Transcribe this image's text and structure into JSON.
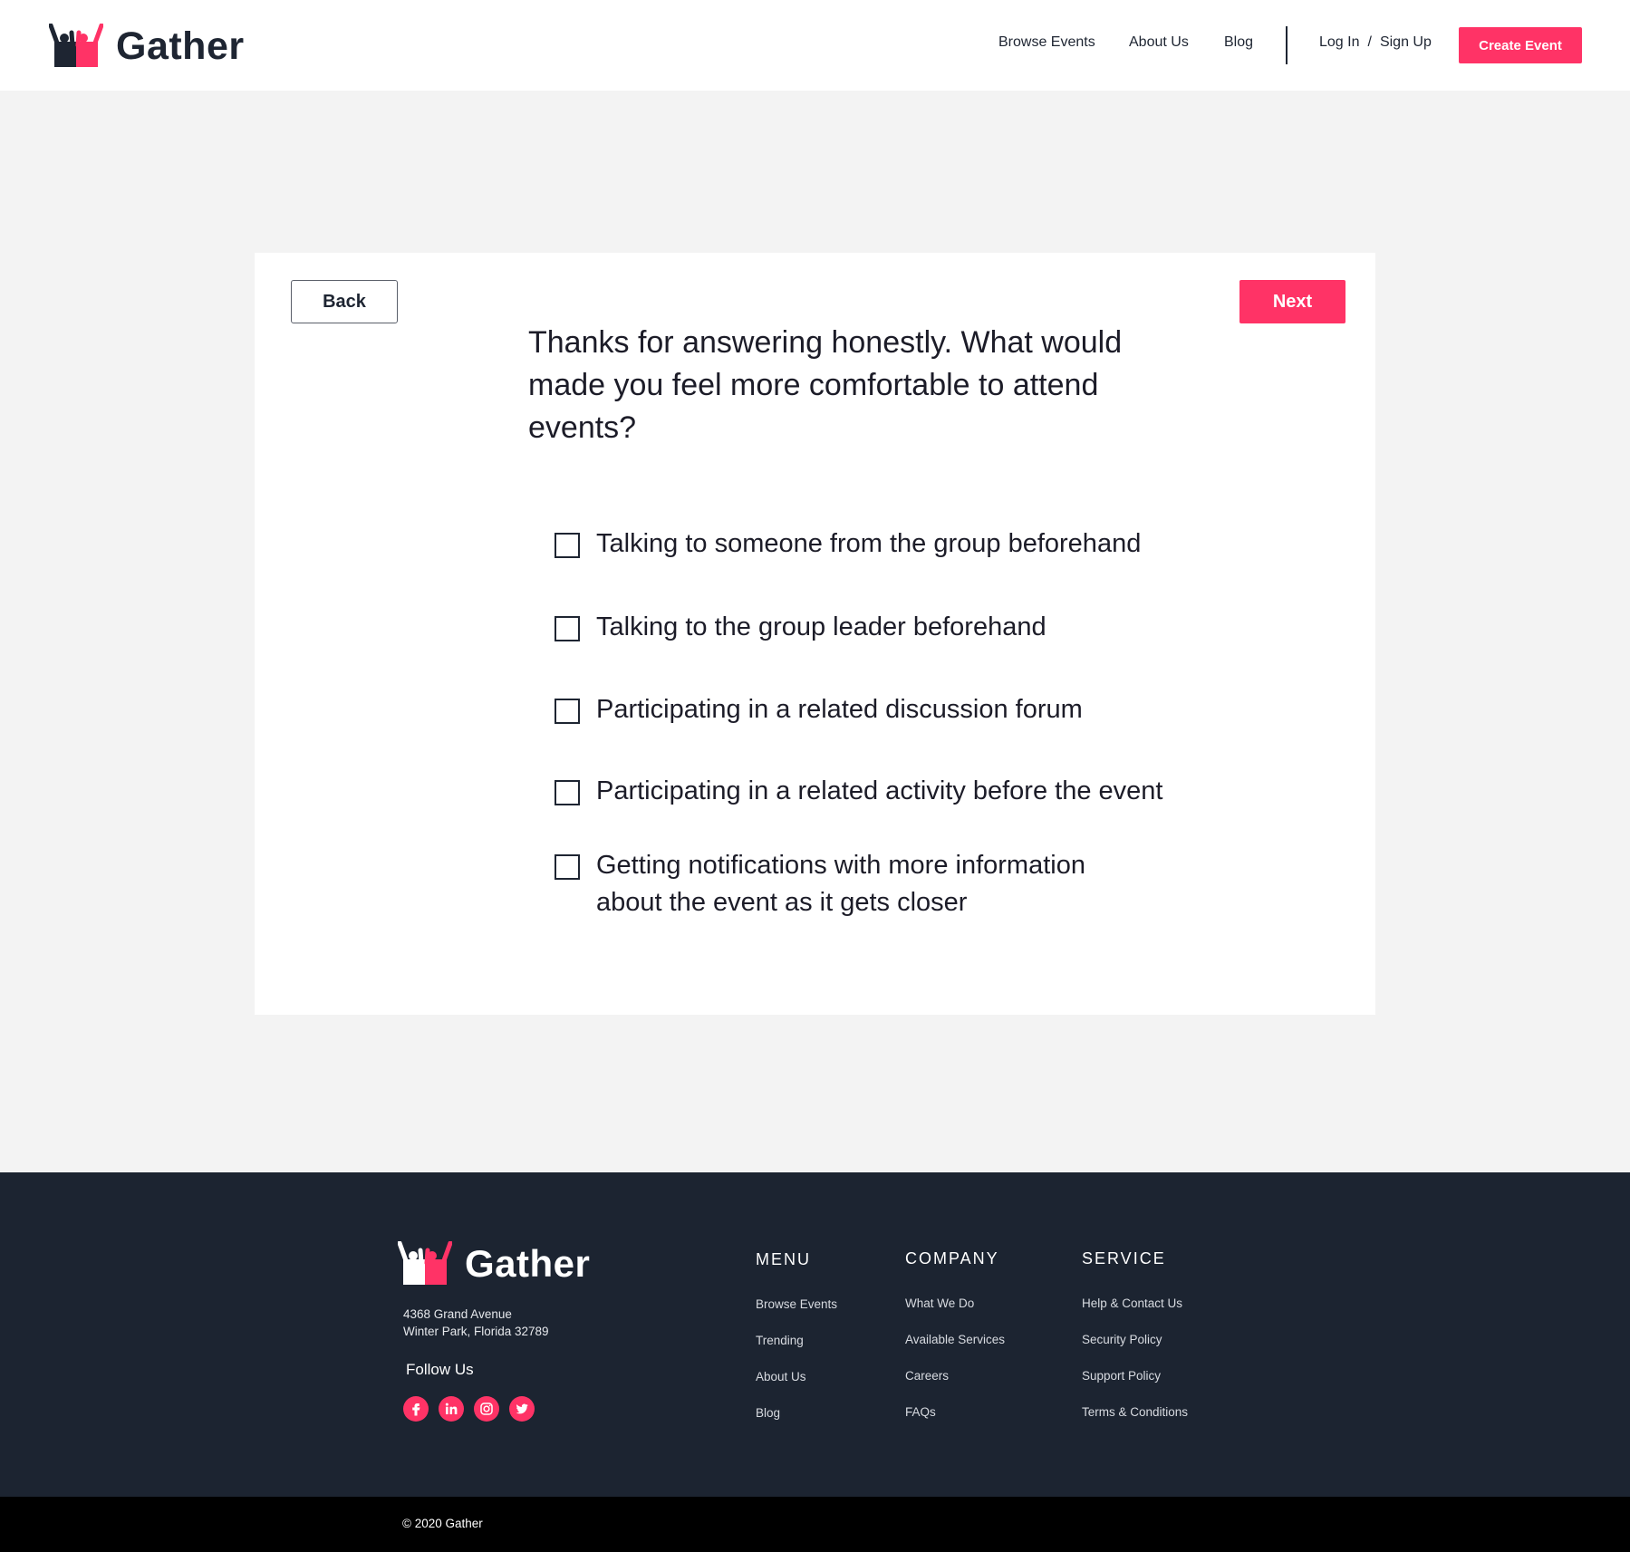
{
  "header": {
    "brand": "Gather",
    "nav": [
      "Browse Events",
      "About Us",
      "Blog"
    ],
    "login": "Log In",
    "separator": "/",
    "signup": "Sign Up",
    "create_event": "Create Event"
  },
  "survey": {
    "back_label": "Back",
    "next_label": "Next",
    "question": "Thanks for answering honestly. What would made you feel more comfortable to attend events?",
    "options": [
      "Talking to someone from the group beforehand",
      "Talking to the group leader beforehand",
      "Participating in a related discussion forum",
      "Participating in a related activity before the event",
      "Getting notifications with more information about the event as it gets closer"
    ]
  },
  "footer": {
    "brand": "Gather",
    "address_line1": "4368 Grand Avenue",
    "address_line2": "Winter Park, Florida 32789",
    "follow_us": "Follow Us",
    "socials": [
      "facebook-icon",
      "linkedin-icon",
      "instagram-icon",
      "twitter-icon"
    ],
    "menu": {
      "title": "MENU",
      "items": [
        "Browse Events",
        "Trending",
        "About Us",
        "Blog"
      ]
    },
    "company": {
      "title": "COMPANY",
      "items": [
        "What We Do",
        "Available Services",
        "Careers",
        "FAQs"
      ]
    },
    "service": {
      "title": "SERVICE",
      "items": [
        "Help & Contact Us",
        "Security Policy",
        "Support Policy",
        "Terms & Conditions"
      ]
    },
    "copyright": "© 2020 Gather"
  },
  "colors": {
    "accent": "#ff3366",
    "dark": "#1c2431",
    "background": "#f3f3f3"
  }
}
